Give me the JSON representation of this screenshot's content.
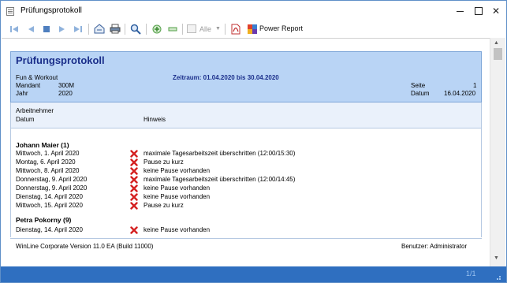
{
  "window": {
    "title": "Prüfungsprotokoll"
  },
  "toolbar": {
    "filter_value": "Alle",
    "power_report_label": "Power Report",
    "icons": [
      "first-page-icon",
      "previous-page-icon",
      "stop-icon",
      "next-page-icon",
      "last-page-icon",
      "export-icon",
      "print-icon",
      "search-icon",
      "zoom-in-icon",
      "zoom-out-icon",
      "pdf-icon",
      "power-report-icon"
    ]
  },
  "report": {
    "title": "Prüfungsprotokoll",
    "company": "Fun & Workout",
    "mandant_label": "Mandant",
    "mandant_value": "300M",
    "jahr_label": "Jahr",
    "jahr_value": "2020",
    "zeitraum": "Zeitraum: 01.04.2020 bis 30.04.2020",
    "seite_label": "Seite",
    "seite_value": "1",
    "datum_label": "Datum",
    "datum_value": "16.04.2020",
    "columns": {
      "arbeitnehmer": "Arbeitnehmer",
      "datum": "Datum",
      "hinweis": "Hinweis"
    },
    "employees": [
      {
        "name": "Johann Maier (1)",
        "rows": [
          {
            "date": "Mittwoch, 1. April 2020",
            "hint": "maximale Tagesarbeitszeit überschritten (12:00/15:30)"
          },
          {
            "date": "Montag, 6. April 2020",
            "hint": "Pause zu kurz"
          },
          {
            "date": "Mittwoch, 8. April 2020",
            "hint": "keine Pause vorhanden"
          },
          {
            "date": "Donnerstag, 9. April 2020",
            "hint": "maximale Tagesarbeitszeit überschritten (12:00/14:45)"
          },
          {
            "date": "Donnerstag, 9. April 2020",
            "hint": "keine Pause vorhanden"
          },
          {
            "date": "Dienstag, 14. April 2020",
            "hint": "keine Pause vorhanden"
          },
          {
            "date": "Mittwoch, 15. April 2020",
            "hint": "Pause zu kurz"
          }
        ]
      },
      {
        "name": "Petra Pokorny (9)",
        "rows": [
          {
            "date": "Dienstag, 14. April 2020",
            "hint": "keine Pause vorhanden"
          }
        ]
      }
    ],
    "footer_left": "WinLine Corporate Version 11.0 EA (Build 11000)",
    "footer_right": "Benutzer: Administrator"
  },
  "status": {
    "page_indicator": "1/1"
  },
  "colors": {
    "header_bg": "#b9d4f5",
    "title_color": "#1a2e8a",
    "statusbar": "#2f6fc0",
    "error_red": "#d42020"
  }
}
